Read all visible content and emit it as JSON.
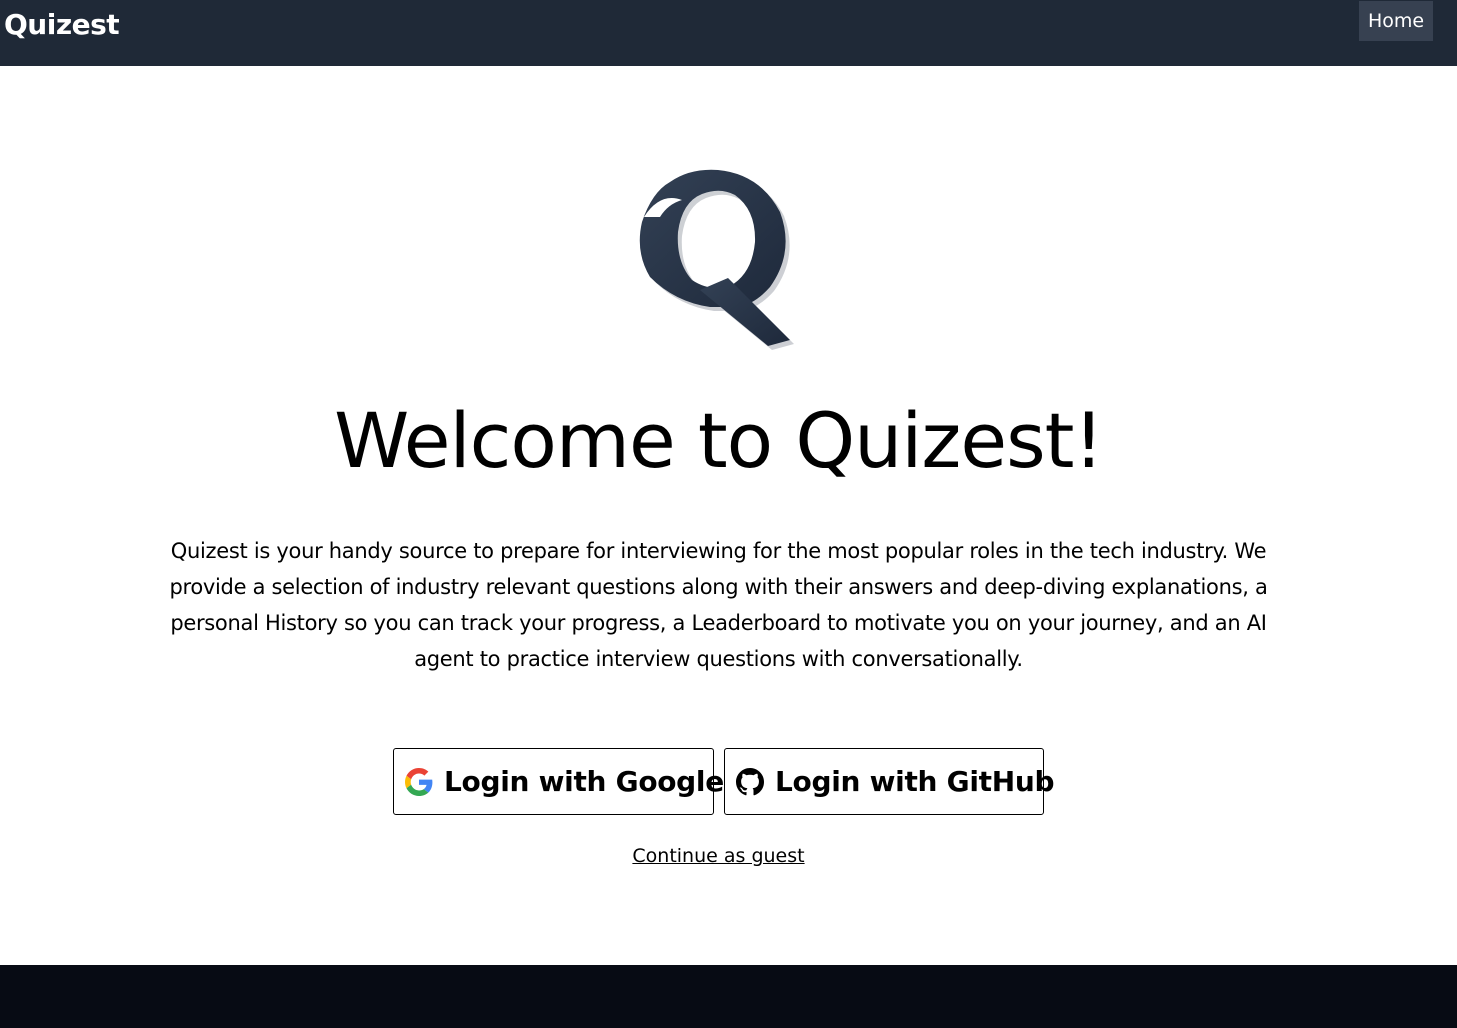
{
  "header": {
    "brand": "Quizest",
    "nav_home": "Home"
  },
  "hero": {
    "logo_icon": "quizest-q-logo",
    "title": "Welcome to Quizest!",
    "description": "Quizest is your handy source to prepare for interviewing for the most popular roles in the tech industry. We provide a selection of industry relevant questions along with their answers and deep-diving explanations, a personal History so you can track your progress, a Leaderboard to motivate you on your journey, and an AI agent to practice interview questions with conversationally."
  },
  "auth": {
    "google": {
      "icon": "google-icon",
      "label": "Login with Google"
    },
    "github": {
      "icon": "github-icon",
      "label": "Login with GitHub"
    },
    "guest_label": "Continue as guest"
  },
  "colors": {
    "navbar_bg": "#1f2937",
    "home_button_bg": "#374151",
    "footer_bg": "#070b14",
    "logo": "#1f2937"
  }
}
